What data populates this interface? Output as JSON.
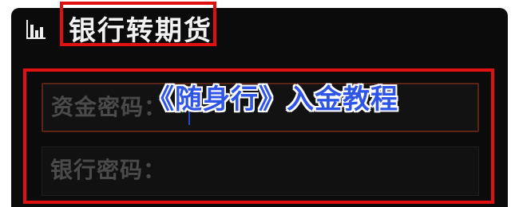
{
  "header": {
    "icon": "bar-chart-icon",
    "title": "银行转期货"
  },
  "form": {
    "fields": [
      {
        "label": "资金密码：",
        "value": "",
        "state": "focused"
      },
      {
        "label": "银行密码：",
        "value": "",
        "state": "idle"
      }
    ]
  },
  "overlay": {
    "caption": "《随身行》入金教程"
  },
  "colors": {
    "panel_background": "#0b0b0b",
    "highlight_border": "#e01010",
    "caption_color": "#2f55e8",
    "label_color": "#4a4a4a"
  }
}
